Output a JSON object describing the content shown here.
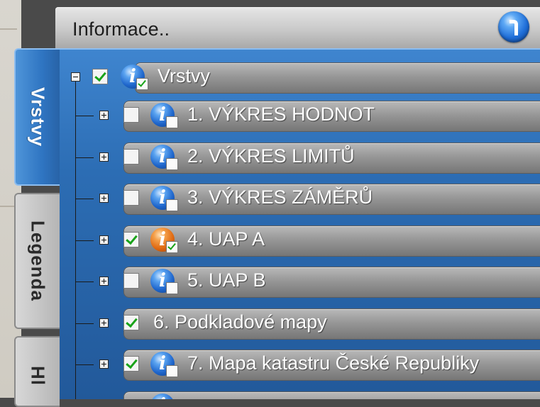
{
  "header": {
    "title": "Informace.."
  },
  "tabs": [
    {
      "label": "Vrstvy",
      "active": true
    },
    {
      "label": "Legenda",
      "active": false
    },
    {
      "label": "Hl",
      "active": false
    }
  ],
  "tree": {
    "root": {
      "label": "Vrstvy",
      "checked": true,
      "expanded": true
    },
    "items": [
      {
        "label": "1. VÝKRES HODNOT",
        "checked": false,
        "icon": "info-blue-icon"
      },
      {
        "label": "2. VÝKRES LIMITŮ",
        "checked": false,
        "icon": "info-blue-icon"
      },
      {
        "label": "3. VÝKRES ZÁMĚRŮ",
        "checked": false,
        "icon": "info-blue-icon"
      },
      {
        "label": "4. UAP A",
        "checked": true,
        "icon": "info-orange-icon"
      },
      {
        "label": "5. UAP B",
        "checked": false,
        "icon": "info-blue-icon"
      },
      {
        "label": "6. Podkladové mapy",
        "checked": true,
        "icon": "none"
      },
      {
        "label": "7. Mapa katastru České Republiky",
        "checked": true,
        "icon": "info-blue-icon"
      }
    ]
  },
  "colors": {
    "tab_active": "#2f75c2",
    "check_green": "#19a319",
    "row_gray": "#979797"
  }
}
